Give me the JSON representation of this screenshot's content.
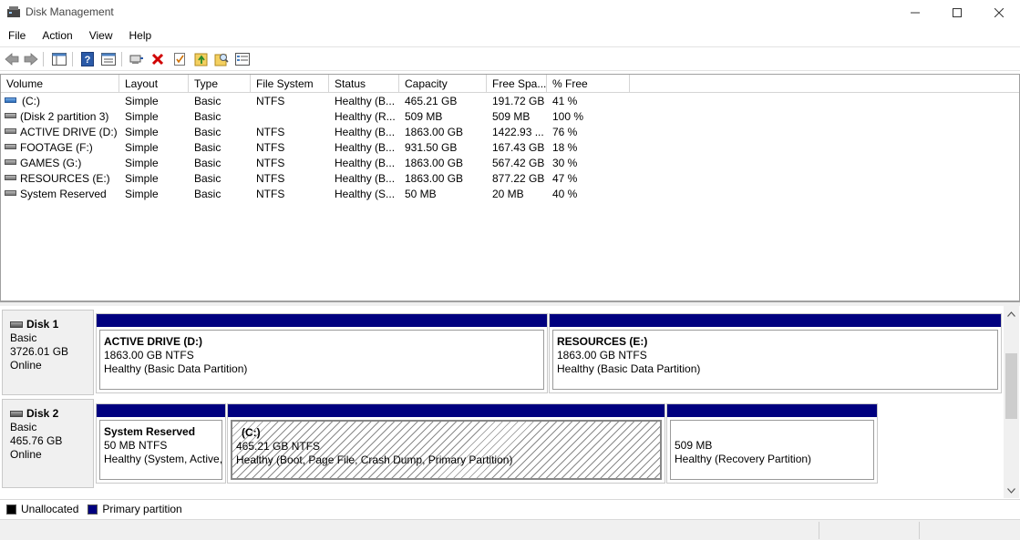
{
  "window": {
    "title": "Disk Management",
    "minimize_label": "—",
    "maximize_label": "☐",
    "close_label": "✕"
  },
  "menu": [
    "File",
    "Action",
    "View",
    "Help"
  ],
  "toolbar": {
    "icons": [
      "back-arrow-icon",
      "forward-arrow-icon",
      "console-tree-icon",
      "help-icon",
      "properties-list-icon",
      "connect-disk-icon",
      "delete-icon",
      "check-properties-icon",
      "folder-up-icon",
      "search-folder-icon",
      "details-view-icon"
    ]
  },
  "volume_list": {
    "columns": [
      "Volume",
      "Layout",
      "Type",
      "File System",
      "Status",
      "Capacity",
      "Free Spa...",
      "% Free"
    ],
    "rows": [
      {
        "volume": "(C:)",
        "layout": "Simple",
        "type": "Basic",
        "fs": "NTFS",
        "status": "Healthy (B...",
        "capacity": "465.21 GB",
        "free": "191.72 GB",
        "pct": "41 %"
      },
      {
        "volume": "(Disk 2 partition 3)",
        "layout": "Simple",
        "type": "Basic",
        "fs": "",
        "status": "Healthy (R...",
        "capacity": "509 MB",
        "free": "509 MB",
        "pct": "100 %"
      },
      {
        "volume": "ACTIVE DRIVE (D:)",
        "layout": "Simple",
        "type": "Basic",
        "fs": "NTFS",
        "status": "Healthy (B...",
        "capacity": "1863.00 GB",
        "free": "1422.93 ...",
        "pct": "76 %"
      },
      {
        "volume": "FOOTAGE (F:)",
        "layout": "Simple",
        "type": "Basic",
        "fs": "NTFS",
        "status": "Healthy (B...",
        "capacity": "931.50 GB",
        "free": "167.43 GB",
        "pct": "18 %"
      },
      {
        "volume": "GAMES (G:)",
        "layout": "Simple",
        "type": "Basic",
        "fs": "NTFS",
        "status": "Healthy (B...",
        "capacity": "1863.00 GB",
        "free": "567.42 GB",
        "pct": "30 %"
      },
      {
        "volume": "RESOURCES (E:)",
        "layout": "Simple",
        "type": "Basic",
        "fs": "NTFS",
        "status": "Healthy (B...",
        "capacity": "1863.00 GB",
        "free": "877.22 GB",
        "pct": "47 %"
      },
      {
        "volume": "System Reserved",
        "layout": "Simple",
        "type": "Basic",
        "fs": "NTFS",
        "status": "Healthy (S...",
        "capacity": "50 MB",
        "free": "20 MB",
        "pct": "40 %"
      }
    ]
  },
  "disks": [
    {
      "name": "Disk 1",
      "type": "Basic",
      "size": "3726.01 GB",
      "state": "Online",
      "partitions": [
        {
          "title": "ACTIVE DRIVE  (D:)",
          "size": "1863.00 GB NTFS",
          "status": "Healthy (Basic Data Partition)"
        },
        {
          "title": "RESOURCES  (E:)",
          "size": "1863.00 GB NTFS",
          "status": "Healthy (Basic Data Partition)"
        }
      ]
    },
    {
      "name": "Disk 2",
      "type": "Basic",
      "size": "465.76 GB",
      "state": "Online",
      "partitions": [
        {
          "title": "System Reserved",
          "size": "50 MB NTFS",
          "status": "Healthy (System, Active,"
        },
        {
          "title": "(C:)",
          "size": "465.21 GB NTFS",
          "status": "Healthy (Boot, Page File, Crash Dump, Primary Partition)"
        },
        {
          "title": "",
          "size": "509 MB",
          "status": "Healthy (Recovery Partition)"
        }
      ]
    }
  ],
  "legend": [
    {
      "label": "Unallocated",
      "color": "#000000"
    },
    {
      "label": "Primary partition",
      "color": "#00007f"
    }
  ],
  "colors": {
    "partition_bar": "#00007f",
    "unallocated": "#000000"
  }
}
